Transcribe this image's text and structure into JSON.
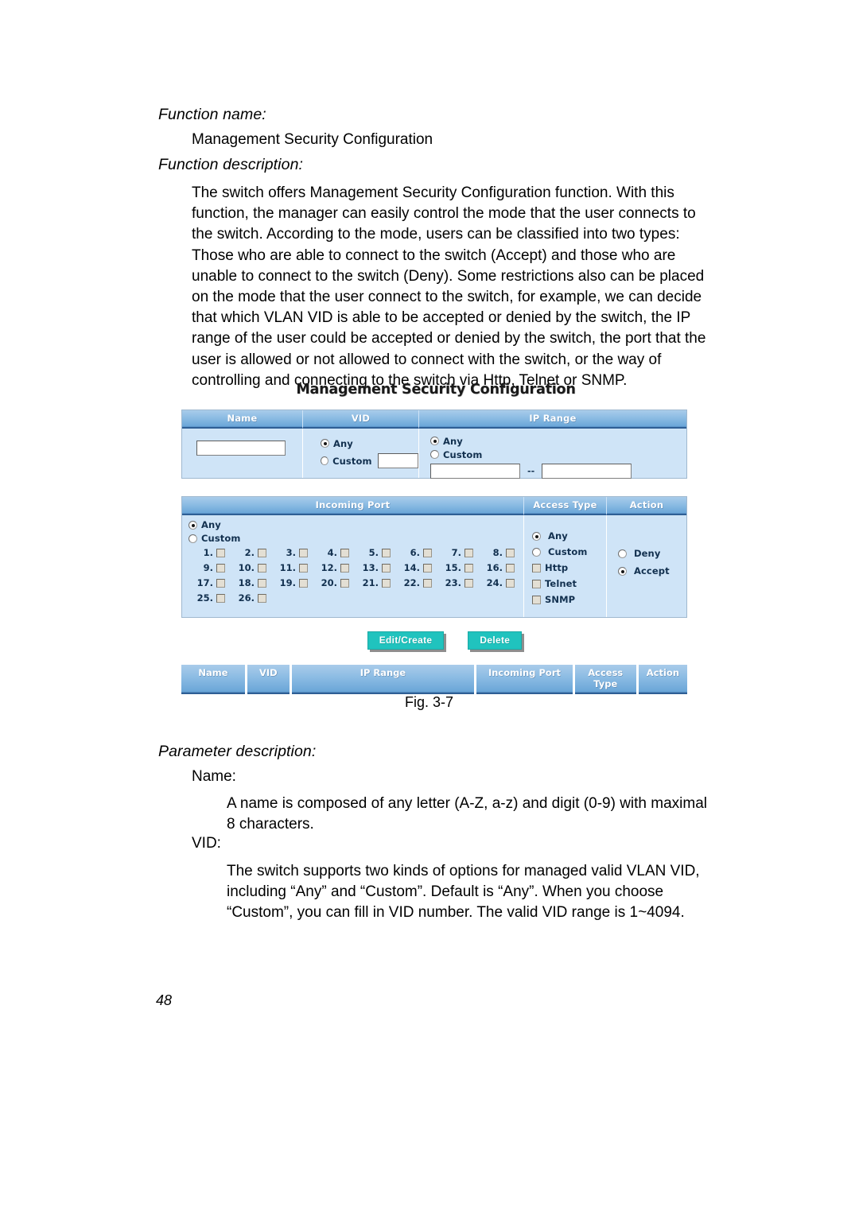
{
  "document": {
    "page_number": "48",
    "figure_caption": "Fig. 3-7"
  },
  "sections": {
    "function_name_heading": "Function name:",
    "function_name_value": "Management Security Configuration",
    "function_description_heading": "Function description:",
    "function_description_lines": [
      "The switch offers Management Security Configuration function. With this",
      "function, the manager can easily control the mode that the user connects to",
      "the switch. According to the mode, users can be classified into two types:",
      "Those who are able to connect to the switch (Accept) and those who are",
      "unable to connect to the switch (Deny). Some restrictions also can be placed",
      "on the mode that the user connect to the switch, for example, we can decide",
      "that which VLAN VID is able to be accepted or denied by the switch, the IP",
      "range of the user could be accepted or denied by the switch, the port that the",
      "user is allowed or not allowed to connect with the switch, or the way of",
      "controlling and connecting to the switch via Http, Telnet or SNMP."
    ],
    "parameter_description_heading": "Parameter description:",
    "parameters": [
      {
        "name": "Name:",
        "lines": [
          "A name is composed of any letter (A-Z, a-z) and digit (0-9) with maximal",
          "8 characters."
        ]
      },
      {
        "name": "VID:",
        "lines": [
          "The switch supports two kinds of options for managed valid VLAN VID,",
          "including “Any” and “Custom”. Default is “Any”. When you choose",
          "“Custom”, you can fill in VID number. The valid VID range is 1~4094."
        ]
      }
    ]
  },
  "ui": {
    "title": "Management Security Configuration",
    "colors": {
      "header_blue": "#6aa6d8",
      "header_border": "#2e5f95",
      "panel_background": "#cfe4f7",
      "button_teal": "#20c3be"
    },
    "panel_one": {
      "headers": [
        "Name",
        "VID",
        "IP Range"
      ],
      "name_field": {
        "value": "",
        "placeholder": ""
      },
      "vid": {
        "options": [
          "Any",
          "Custom"
        ],
        "selected": "Any",
        "custom_value": ""
      },
      "ip_range": {
        "options": [
          "Any",
          "Custom"
        ],
        "selected": "Any",
        "separator": "--",
        "start_value": "",
        "end_value": ""
      }
    },
    "panel_two": {
      "headers": [
        "Incoming Port",
        "Access Type",
        "Action"
      ],
      "incoming_port": {
        "options": [
          "Any",
          "Custom"
        ],
        "selected": "Any",
        "ports": [
          "1.",
          "2.",
          "3.",
          "4.",
          "5.",
          "6.",
          "7.",
          "8.",
          "9.",
          "10.",
          "11.",
          "12.",
          "13.",
          "14.",
          "15.",
          "16.",
          "17.",
          "18.",
          "19.",
          "20.",
          "21.",
          "22.",
          "23.",
          "24.",
          "25.",
          "26."
        ],
        "checked_ports": []
      },
      "access_type": {
        "radio_options": [
          "Any",
          "Custom"
        ],
        "selected": "Any",
        "checkbox_options": [
          "Http",
          "Telnet",
          "SNMP"
        ],
        "checked": []
      },
      "action": {
        "options": [
          "Deny",
          "Accept"
        ],
        "selected": "Accept"
      }
    },
    "buttons": {
      "edit_create": "Edit/Create",
      "delete": "Delete"
    },
    "summary_headers": [
      "Name",
      "VID",
      "IP Range",
      "Incoming Port",
      "Access Type",
      "Action"
    ]
  }
}
